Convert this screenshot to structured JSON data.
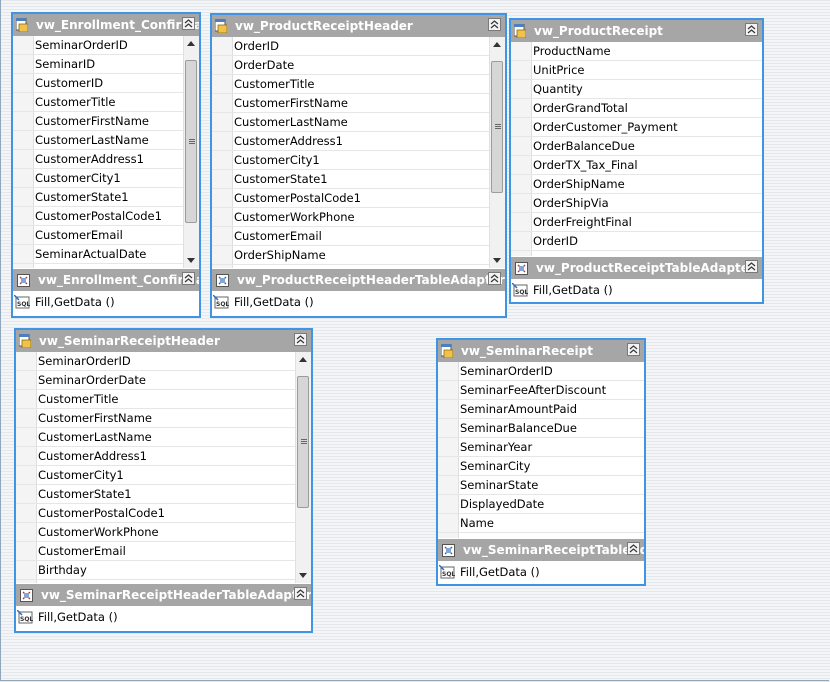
{
  "tables": [
    {
      "id": "enrollment",
      "title": "vw_Enrollment_Confirmat",
      "columns": [
        "SeminarOrderID",
        "SeminarID",
        "CustomerID",
        "CustomerTitle",
        "CustomerFirstName",
        "CustomerLastName",
        "CustomerAddress1",
        "CustomerCity1",
        "CustomerState1",
        "CustomerPostalCode1",
        "CustomerEmail",
        "SeminarActualDate"
      ],
      "adapter": {
        "title": "vw_Enrollment_Confirmat",
        "query": "Fill,GetData ()"
      },
      "scroll": {
        "thumb_start": 0.05,
        "thumb_end": 0.85
      }
    },
    {
      "id": "product-receipt-header",
      "title": "vw_ProductReceiptHeader",
      "columns": [
        "OrderID",
        "OrderDate",
        "CustomerTitle",
        "CustomerFirstName",
        "CustomerLastName",
        "CustomerAddress1",
        "CustomerCity1",
        "CustomerState1",
        "CustomerPostalCode1",
        "CustomerWorkPhone",
        "CustomerEmail",
        "OrderShipName"
      ],
      "adapter": {
        "title": "vw_ProductReceiptHeaderTableAdapter",
        "query": "Fill,GetData ()"
      },
      "scroll": {
        "thumb_start": 0.05,
        "thumb_end": 0.7
      }
    },
    {
      "id": "product-receipt",
      "title": "vw_ProductReceipt",
      "columns": [
        "ProductName",
        "UnitPrice",
        "Quantity",
        "OrderGrandTotal",
        "OrderCustomer_Payment",
        "OrderBalanceDue",
        "OrderTX_Tax_Final",
        "OrderShipName",
        "OrderShipVia",
        "OrderFreightFinal",
        "OrderID"
      ],
      "adapter": {
        "title": "vw_ProductReceiptTableAdapter",
        "query": "Fill,GetData ()"
      }
    },
    {
      "id": "seminar-receipt-header",
      "title": "vw_SeminarReceiptHeader",
      "columns": [
        "SeminarOrderID",
        "SeminarOrderDate",
        "CustomerTitle",
        "CustomerFirstName",
        "CustomerLastName",
        "CustomerAddress1",
        "CustomerCity1",
        "CustomerState1",
        "CustomerPostalCode1",
        "CustomerWorkPhone",
        "CustomerEmail",
        "Birthday"
      ],
      "adapter": {
        "title": "vw_SeminarReceiptHeaderTableAdapter",
        "query": "Fill,GetData ()"
      },
      "scroll": {
        "thumb_start": 0.05,
        "thumb_end": 0.7
      }
    },
    {
      "id": "seminar-receipt",
      "title": "vw_SeminarReceipt",
      "columns": [
        "SeminarOrderID",
        "SeminarFeeAfterDiscount",
        "SeminarAmountPaid",
        "SeminarBalanceDue",
        "SeminarYear",
        "SeminarCity",
        "SeminarState",
        "DisplayedDate",
        "Name"
      ],
      "adapter": {
        "title": "vw_SeminarReceiptTableAda",
        "query": "Fill,GetData ()"
      }
    }
  ],
  "colors": {
    "selection_border": "#3f94e4",
    "header_bg": "#a6a6a6",
    "header_text": "#ffffff"
  }
}
